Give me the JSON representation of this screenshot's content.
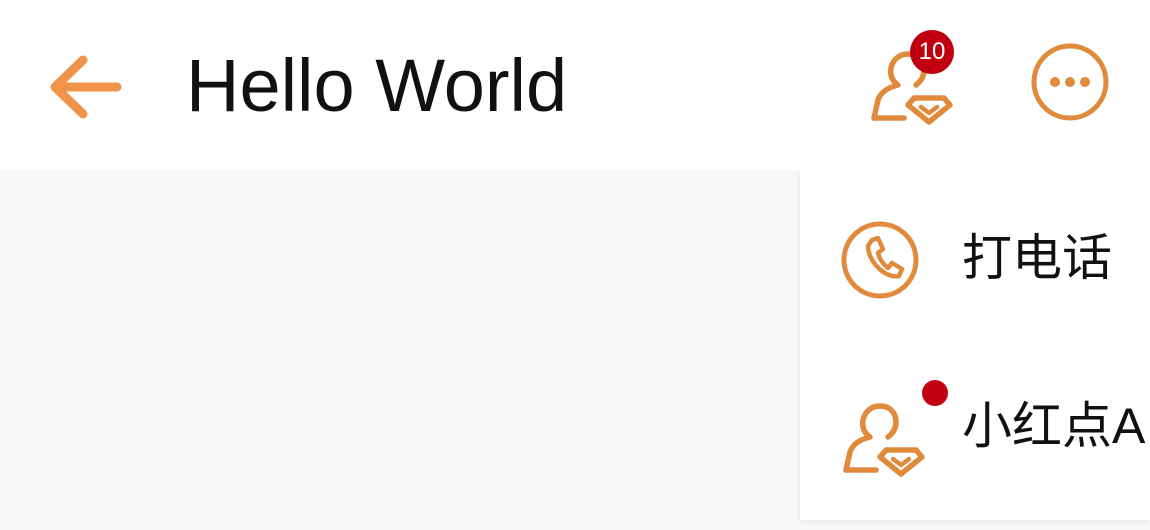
{
  "toolbar": {
    "title": "Hello World",
    "back_icon": "arrow-left-icon",
    "vip_icon": "user-diamond-icon",
    "vip_badge_count": "10",
    "more_icon": "more-horizontal-icon"
  },
  "menu": {
    "items": [
      {
        "label": "打电话",
        "icon": "phone-icon"
      },
      {
        "label": "小红点A",
        "icon": "user-diamond-icon",
        "has_dot": true
      }
    ]
  },
  "colors": {
    "accent": "#f0944a",
    "icon_orange": "#e08a3c",
    "badge_red": "#c00010",
    "toolbar_bg": "#ffffff",
    "content_bg": "#f8f8f8"
  }
}
